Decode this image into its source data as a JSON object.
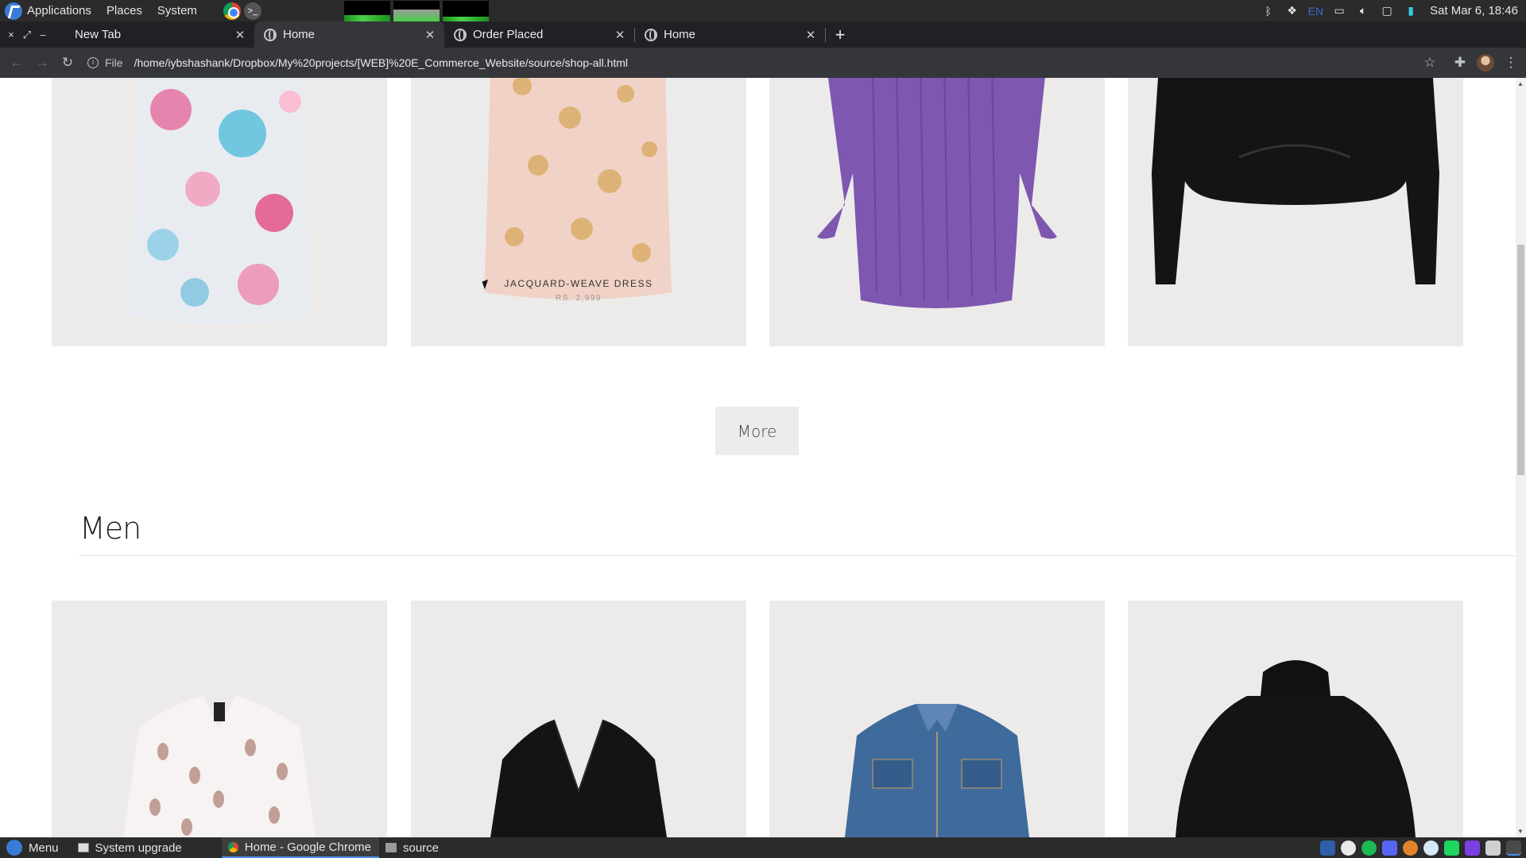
{
  "panel": {
    "menus": [
      "Applications",
      "Places",
      "System"
    ],
    "lang": "EN",
    "clock": "Sat Mar  6, 18:46"
  },
  "browser": {
    "window_controls": [
      "×",
      "⤢",
      "–"
    ],
    "tabs": [
      {
        "title": "New Tab",
        "active": false
      },
      {
        "title": "Home",
        "active": true
      },
      {
        "title": "Order Placed",
        "active": false
      },
      {
        "title": "Home",
        "active": false
      }
    ],
    "new_tab": "+",
    "scheme": "File",
    "url": "/home/iybshashank/Dropbox/My%20projects/[WEB]%20E_Commerce_Website/source/shop-all.html"
  },
  "page": {
    "women_products": [
      {
        "name": "",
        "price": "",
        "art": "floral-sequin-dress"
      },
      {
        "name": "JACQUARD-WEAVE DRESS",
        "price": "RS. 2,999",
        "art": "jacquard-dress"
      },
      {
        "name": "",
        "price": "",
        "art": "purple-dress"
      },
      {
        "name": "",
        "price": "",
        "art": "black-top"
      }
    ],
    "more_label": "More",
    "section_title": "Men",
    "men_products": [
      {
        "name": "",
        "price": "",
        "art": "paisley-shirt"
      },
      {
        "name": "",
        "price": "",
        "art": "black-blazer"
      },
      {
        "name": "",
        "price": "",
        "art": "denim-jacket"
      },
      {
        "name": "",
        "price": "",
        "art": "black-turtleneck"
      }
    ]
  },
  "taskbar": {
    "menu_label": "Menu",
    "tasks": [
      "System upgrade",
      "Home - Google Chrome",
      "source"
    ],
    "active_task": "Home - Google Chrome"
  },
  "colors": {
    "panel_bg": "#2b2b2b",
    "tabstrip_bg": "#202124",
    "toolbar_bg": "#35363a",
    "card_bg": "#ecebea",
    "accent": "#4a8fe7"
  }
}
